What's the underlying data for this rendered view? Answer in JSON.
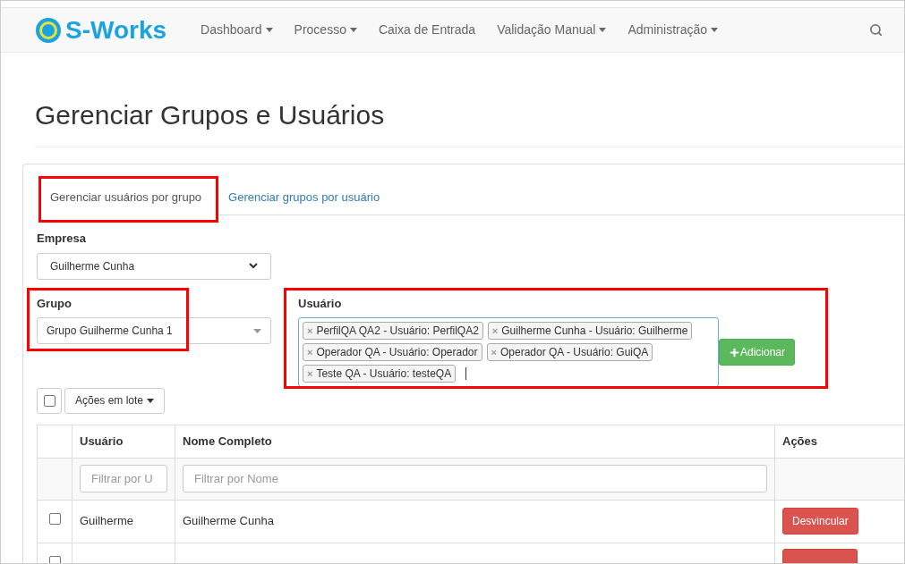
{
  "brand": {
    "name": "S-Works"
  },
  "nav": [
    {
      "label": "Dashboard",
      "dropdown": true
    },
    {
      "label": "Processo",
      "dropdown": true
    },
    {
      "label": "Caixa de Entrada",
      "dropdown": false
    },
    {
      "label": "Validação Manual",
      "dropdown": true
    },
    {
      "label": "Administração",
      "dropdown": true
    }
  ],
  "title": "Gerenciar Grupos e Usuários",
  "tabs": [
    {
      "label": "Gerenciar usuários por grupo",
      "selected": true,
      "highlighted": true
    },
    {
      "label": "Gerenciar grupos por usuário",
      "selected": false,
      "highlighted": false
    }
  ],
  "empresa": {
    "label": "Empresa",
    "value": "Guilherme Cunha"
  },
  "grupo": {
    "label": "Grupo",
    "value": "Grupo Guilherme Cunha 1",
    "highlighted": true
  },
  "usuario": {
    "label": "Usuário",
    "highlighted": true,
    "remove_glyph": "×",
    "tokens": [
      "PerfilQA QA2 - Usuário: PerfilQA2",
      "Guilherme Cunha - Usuário: Guilherme",
      "Operador QA - Usuário: Operador",
      "Operador QA - Usuário: GuiQA",
      "Teste QA - Usuário: testeQA"
    ],
    "add_button": "Adicionar"
  },
  "bulk": {
    "checked": false,
    "label": "Ações em lote"
  },
  "table": {
    "columns": [
      "Usuário",
      "Nome Completo",
      "Ações"
    ],
    "filters": [
      {
        "placeholder": "Filtrar por U"
      },
      {
        "placeholder": "Filtrar por Nome"
      }
    ],
    "rows": [
      {
        "checked": false,
        "cells": [
          "Guilherme",
          "Guilherme Cunha"
        ],
        "action": "Desvincular"
      },
      {
        "checked": false
      }
    ]
  }
}
